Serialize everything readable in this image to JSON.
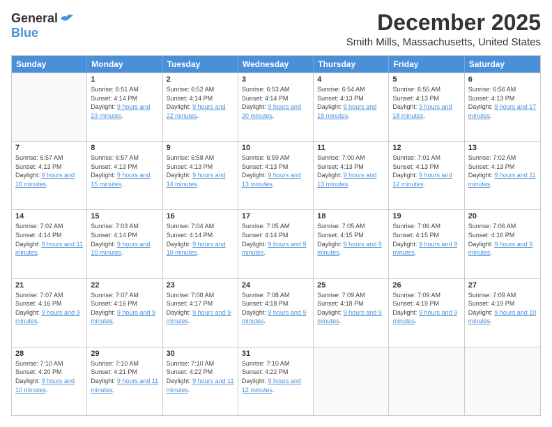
{
  "header": {
    "logo_general": "General",
    "logo_blue": "Blue",
    "month_title": "December 2025",
    "subtitle": "Smith Mills, Massachusetts, United States"
  },
  "days_of_week": [
    "Sunday",
    "Monday",
    "Tuesday",
    "Wednesday",
    "Thursday",
    "Friday",
    "Saturday"
  ],
  "weeks": [
    [
      {
        "day": "",
        "info": ""
      },
      {
        "day": "1",
        "sunrise": "Sunrise: 6:51 AM",
        "sunset": "Sunset: 4:14 PM",
        "daylight": "Daylight: 9 hours and 23 minutes."
      },
      {
        "day": "2",
        "sunrise": "Sunrise: 6:52 AM",
        "sunset": "Sunset: 4:14 PM",
        "daylight": "Daylight: 9 hours and 22 minutes."
      },
      {
        "day": "3",
        "sunrise": "Sunrise: 6:53 AM",
        "sunset": "Sunset: 4:14 PM",
        "daylight": "Daylight: 9 hours and 20 minutes."
      },
      {
        "day": "4",
        "sunrise": "Sunrise: 6:54 AM",
        "sunset": "Sunset: 4:13 PM",
        "daylight": "Daylight: 9 hours and 19 minutes."
      },
      {
        "day": "5",
        "sunrise": "Sunrise: 6:55 AM",
        "sunset": "Sunset: 4:13 PM",
        "daylight": "Daylight: 9 hours and 18 minutes."
      },
      {
        "day": "6",
        "sunrise": "Sunrise: 6:56 AM",
        "sunset": "Sunset: 4:13 PM",
        "daylight": "Daylight: 9 hours and 17 minutes."
      }
    ],
    [
      {
        "day": "7",
        "sunrise": "Sunrise: 6:57 AM",
        "sunset": "Sunset: 4:13 PM",
        "daylight": "Daylight: 9 hours and 16 minutes."
      },
      {
        "day": "8",
        "sunrise": "Sunrise: 6:57 AM",
        "sunset": "Sunset: 4:13 PM",
        "daylight": "Daylight: 9 hours and 15 minutes."
      },
      {
        "day": "9",
        "sunrise": "Sunrise: 6:58 AM",
        "sunset": "Sunset: 4:13 PM",
        "daylight": "Daylight: 9 hours and 14 minutes."
      },
      {
        "day": "10",
        "sunrise": "Sunrise: 6:59 AM",
        "sunset": "Sunset: 4:13 PM",
        "daylight": "Daylight: 9 hours and 13 minutes."
      },
      {
        "day": "11",
        "sunrise": "Sunrise: 7:00 AM",
        "sunset": "Sunset: 4:13 PM",
        "daylight": "Daylight: 9 hours and 13 minutes."
      },
      {
        "day": "12",
        "sunrise": "Sunrise: 7:01 AM",
        "sunset": "Sunset: 4:13 PM",
        "daylight": "Daylight: 9 hours and 12 minutes."
      },
      {
        "day": "13",
        "sunrise": "Sunrise: 7:02 AM",
        "sunset": "Sunset: 4:13 PM",
        "daylight": "Daylight: 9 hours and 11 minutes."
      }
    ],
    [
      {
        "day": "14",
        "sunrise": "Sunrise: 7:02 AM",
        "sunset": "Sunset: 4:14 PM",
        "daylight": "Daylight: 9 hours and 11 minutes."
      },
      {
        "day": "15",
        "sunrise": "Sunrise: 7:03 AM",
        "sunset": "Sunset: 4:14 PM",
        "daylight": "Daylight: 9 hours and 10 minutes."
      },
      {
        "day": "16",
        "sunrise": "Sunrise: 7:04 AM",
        "sunset": "Sunset: 4:14 PM",
        "daylight": "Daylight: 9 hours and 10 minutes."
      },
      {
        "day": "17",
        "sunrise": "Sunrise: 7:05 AM",
        "sunset": "Sunset: 4:14 PM",
        "daylight": "Daylight: 9 hours and 9 minutes."
      },
      {
        "day": "18",
        "sunrise": "Sunrise: 7:05 AM",
        "sunset": "Sunset: 4:15 PM",
        "daylight": "Daylight: 9 hours and 9 minutes."
      },
      {
        "day": "19",
        "sunrise": "Sunrise: 7:06 AM",
        "sunset": "Sunset: 4:15 PM",
        "daylight": "Daylight: 9 hours and 9 minutes."
      },
      {
        "day": "20",
        "sunrise": "Sunrise: 7:06 AM",
        "sunset": "Sunset: 4:16 PM",
        "daylight": "Daylight: 9 hours and 9 minutes."
      }
    ],
    [
      {
        "day": "21",
        "sunrise": "Sunrise: 7:07 AM",
        "sunset": "Sunset: 4:16 PM",
        "daylight": "Daylight: 9 hours and 9 minutes."
      },
      {
        "day": "22",
        "sunrise": "Sunrise: 7:07 AM",
        "sunset": "Sunset: 4:16 PM",
        "daylight": "Daylight: 9 hours and 9 minutes."
      },
      {
        "day": "23",
        "sunrise": "Sunrise: 7:08 AM",
        "sunset": "Sunset: 4:17 PM",
        "daylight": "Daylight: 9 hours and 9 minutes."
      },
      {
        "day": "24",
        "sunrise": "Sunrise: 7:08 AM",
        "sunset": "Sunset: 4:18 PM",
        "daylight": "Daylight: 9 hours and 9 minutes."
      },
      {
        "day": "25",
        "sunrise": "Sunrise: 7:09 AM",
        "sunset": "Sunset: 4:18 PM",
        "daylight": "Daylight: 9 hours and 9 minutes."
      },
      {
        "day": "26",
        "sunrise": "Sunrise: 7:09 AM",
        "sunset": "Sunset: 4:19 PM",
        "daylight": "Daylight: 9 hours and 9 minutes."
      },
      {
        "day": "27",
        "sunrise": "Sunrise: 7:09 AM",
        "sunset": "Sunset: 4:19 PM",
        "daylight": "Daylight: 9 hours and 10 minutes."
      }
    ],
    [
      {
        "day": "28",
        "sunrise": "Sunrise: 7:10 AM",
        "sunset": "Sunset: 4:20 PM",
        "daylight": "Daylight: 9 hours and 10 minutes."
      },
      {
        "day": "29",
        "sunrise": "Sunrise: 7:10 AM",
        "sunset": "Sunset: 4:21 PM",
        "daylight": "Daylight: 9 hours and 11 minutes."
      },
      {
        "day": "30",
        "sunrise": "Sunrise: 7:10 AM",
        "sunset": "Sunset: 4:22 PM",
        "daylight": "Daylight: 9 hours and 11 minutes."
      },
      {
        "day": "31",
        "sunrise": "Sunrise: 7:10 AM",
        "sunset": "Sunset: 4:22 PM",
        "daylight": "Daylight: 9 hours and 12 minutes."
      },
      {
        "day": "",
        "info": ""
      },
      {
        "day": "",
        "info": ""
      },
      {
        "day": "",
        "info": ""
      }
    ]
  ]
}
